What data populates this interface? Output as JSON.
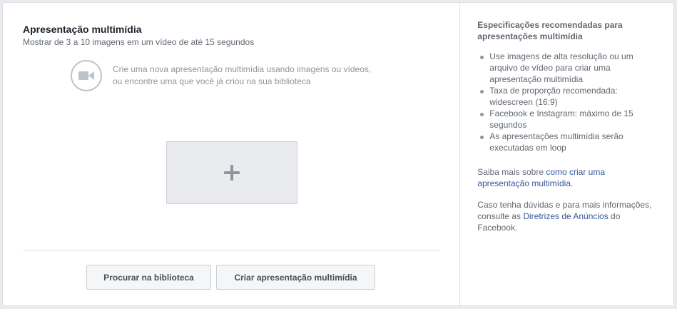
{
  "main": {
    "title": "Apresentação multimídia",
    "subtitle": "Mostrar de 3 a 10 imagens em um vídeo de até 15 segundos",
    "intro_icon": "video-camera-icon",
    "intro_line1": "Crie uma nova apresentação multimídia usando imagens ou vídeos,",
    "intro_line2": "ou encontre uma que você já criou na sua biblioteca",
    "add_icon": "plus-icon",
    "buttons": {
      "library_label": "Procurar na biblioteca",
      "create_label": "Criar apresentação multimídia"
    }
  },
  "sidebar": {
    "heading": "Especificações recomendadas para apresentações multimídia",
    "specs": [
      "Use imagens de alta resolução ou um arquivo de vídeo para criar uma apresentação multimídia",
      "Taxa de proporção recomendada: widescreen (16:9)",
      "Facebook e Instagram: máximo de 15 segundos",
      "As apresentações multimídia serão executadas em loop"
    ],
    "learn_more_prefix": "Saiba mais sobre ",
    "learn_more_link": "como criar uma apresentação multimídia",
    "learn_more_suffix": ".",
    "help_prefix": "Caso tenha dúvidas e para mais informações, consulte as ",
    "help_link": "Diretrizes de Anúncios",
    "help_suffix": " do Facebook."
  },
  "colors": {
    "link": "#365899",
    "text_dark": "#1d2129",
    "text_muted": "#606770",
    "border": "#dddfe2"
  }
}
